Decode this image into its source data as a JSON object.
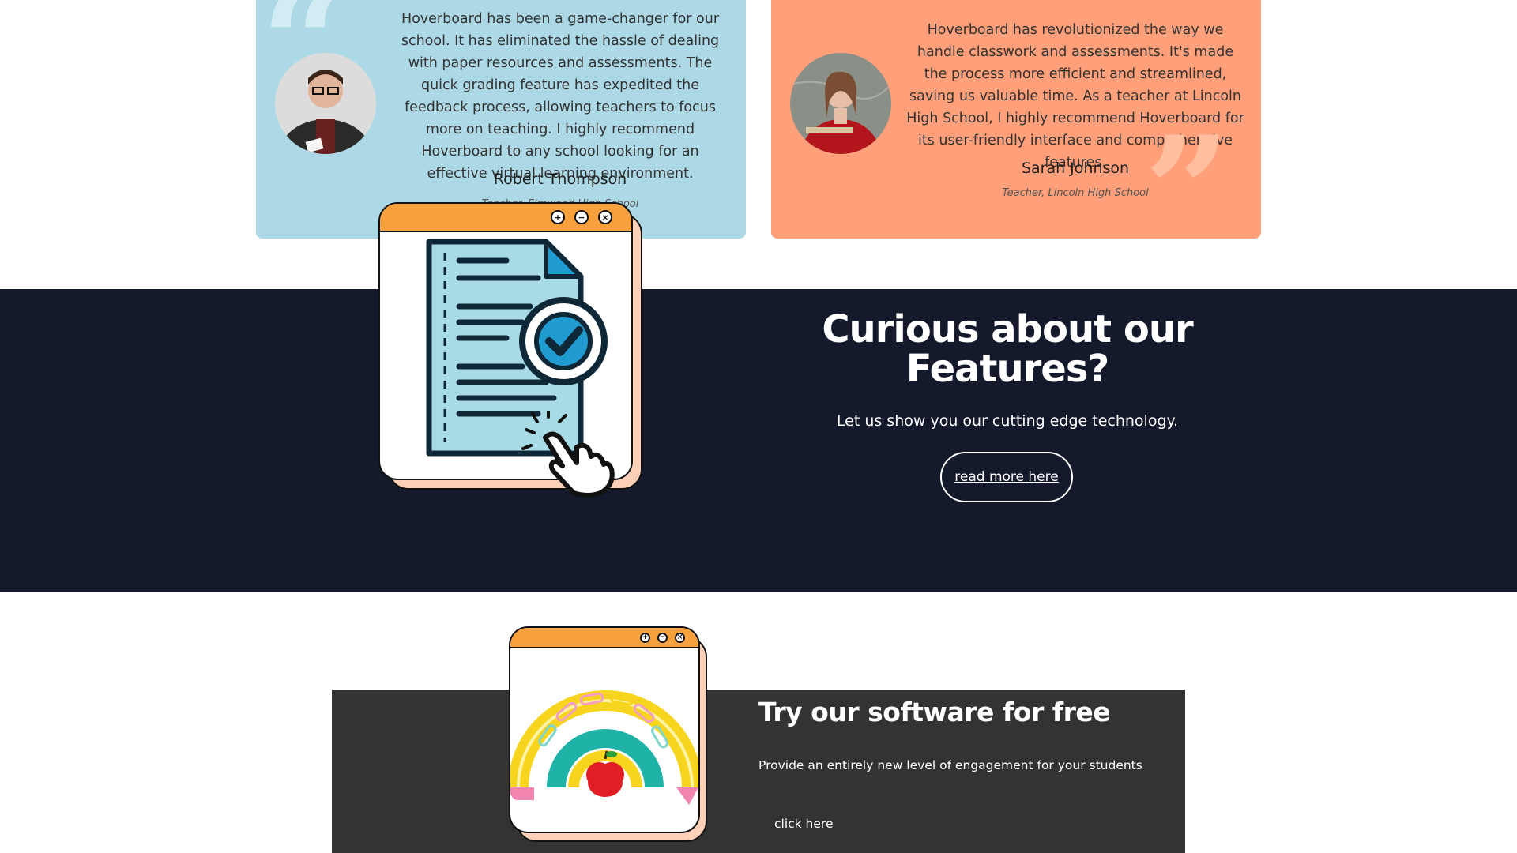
{
  "testimonials": [
    {
      "text": "Hoverboard has been a game-changer for our school. It has eliminated the hassle of dealing with paper resources and assessments. The quick grading feature has expedited the feedback process, allowing teachers to focus more on teaching. I highly recommend Hoverboard to any school looking for an effective virtual learning environment.",
      "author": "Robert Thompson",
      "role": "Teacher, Elmwood High School",
      "accent": "#add8e6"
    },
    {
      "text": "Hoverboard has revolutionized the way we handle classwork and assessments. It's made the process more efficient and streamlined, saving us valuable time. As a teacher at Lincoln High School, I highly recommend Hoverboard for its user-friendly interface and comprehensive features.",
      "author": "Sarah Johnson",
      "role": "Teacher, Lincoln High School",
      "accent": "#ffa07a"
    }
  ],
  "features": {
    "title": "Curious about our Features?",
    "subtitle": "Let us show you our cutting edge technology.",
    "button_label": "read more here",
    "background": "#141a2b"
  },
  "window_controls": {
    "maximize_glyph": "+",
    "minimize_glyph": "−",
    "close_glyph": "×"
  },
  "trial": {
    "title": "Try our software for free",
    "subtitle": "Provide an entirely new level of engagement for your students",
    "link_label": "click here",
    "background": "#333333"
  },
  "icons": [
    "quote-icon",
    "avatar-robert",
    "avatar-sarah",
    "document-check-icon",
    "pointer-hand-icon",
    "rainbow-icon"
  ]
}
